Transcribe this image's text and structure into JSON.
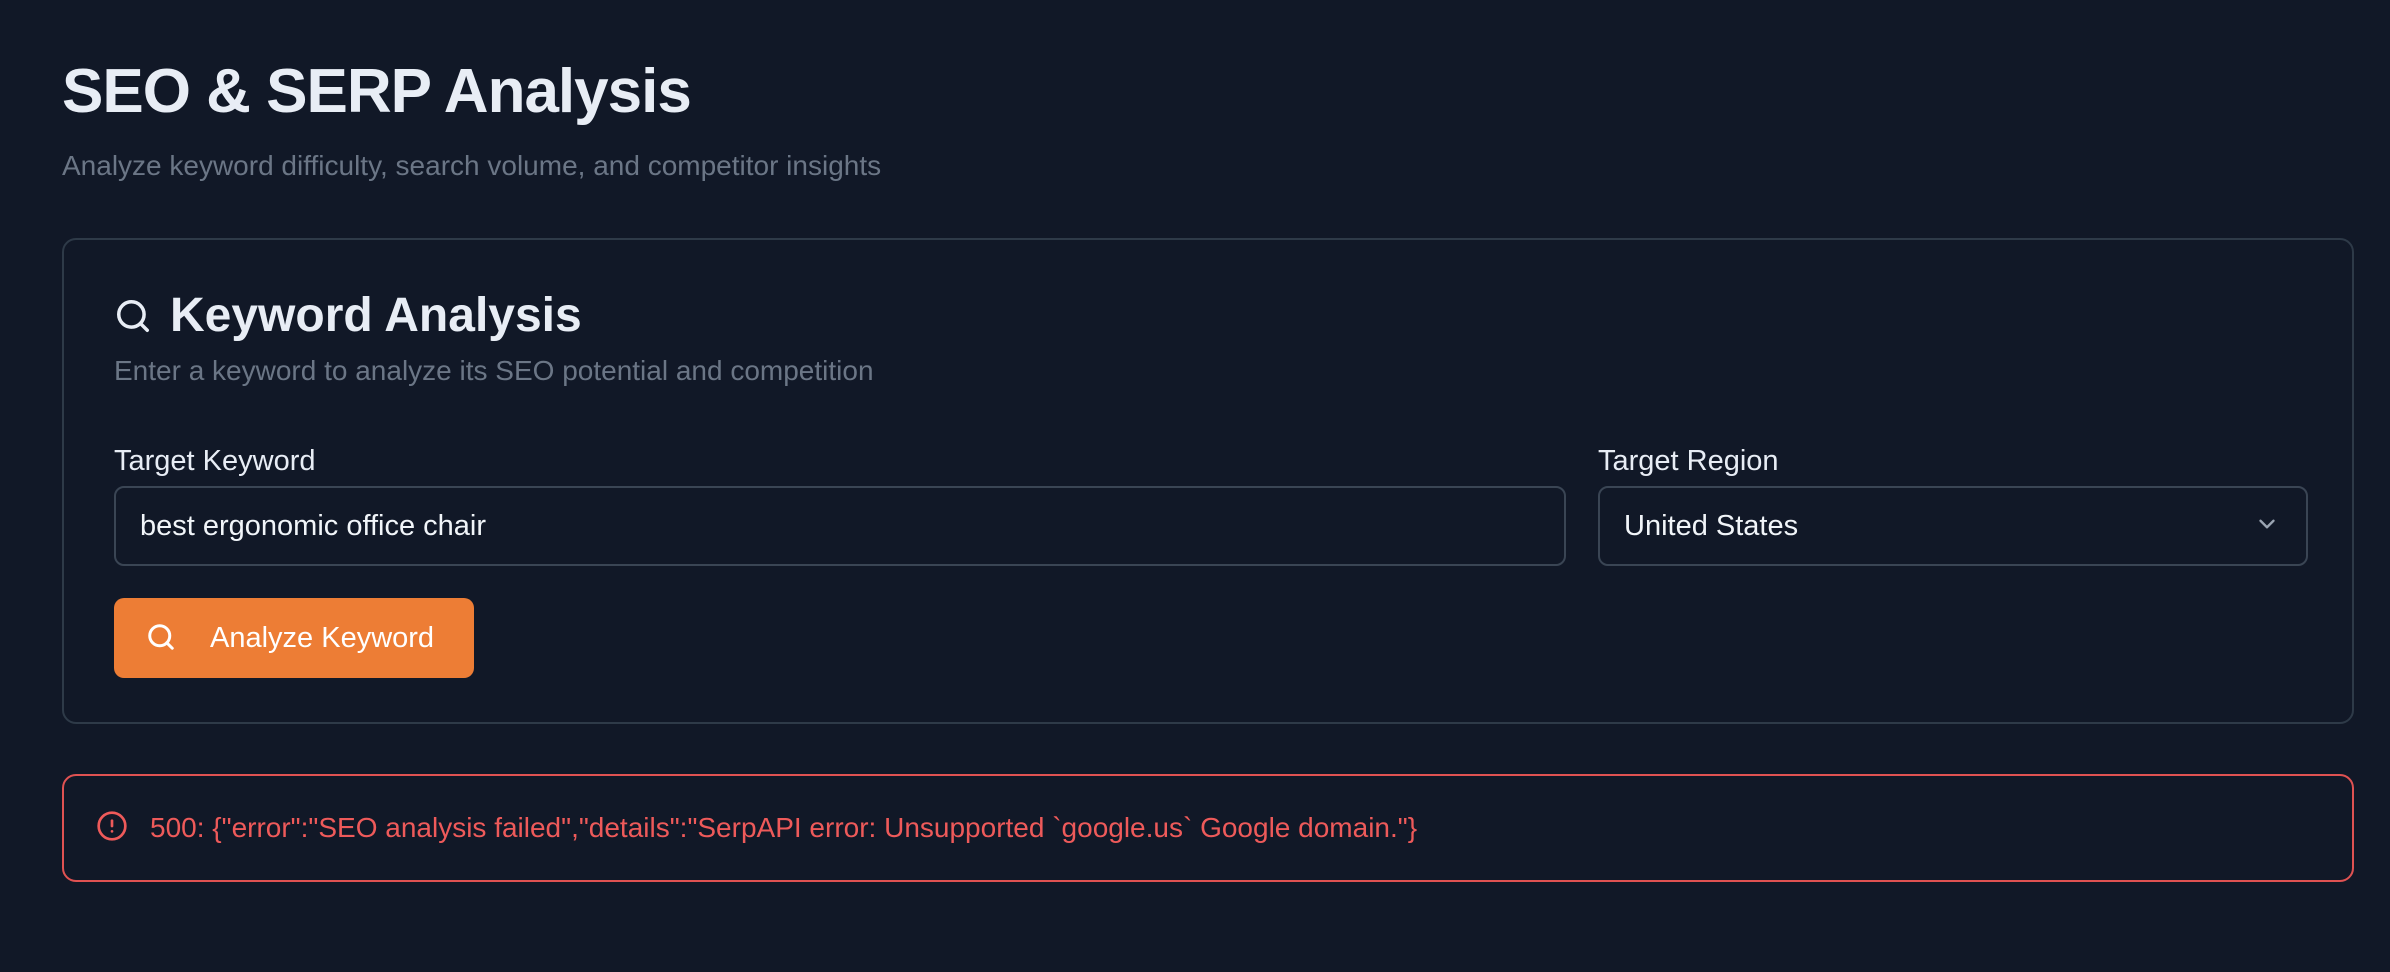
{
  "header": {
    "title": "SEO & SERP Analysis",
    "subtitle": "Analyze keyword difficulty, search volume, and competitor insights"
  },
  "card": {
    "icon": "search-icon",
    "title": "Keyword Analysis",
    "description": "Enter a keyword to analyze its SEO potential and competition"
  },
  "form": {
    "keyword_label": "Target Keyword",
    "keyword_value": "best ergonomic office chair",
    "region_label": "Target Region",
    "region_value": "United States",
    "analyze_label": "Analyze Keyword"
  },
  "error": {
    "icon": "alert-circle-icon",
    "message": "500: {\"error\":\"SEO analysis failed\",\"details\":\"SerpAPI error: Unsupported `google.us` Google domain.\"}"
  },
  "colors": {
    "background": "#111827",
    "accent": "#ed7d35",
    "error": "#e05252",
    "muted_text": "#6b7686",
    "border": "#2e3a48"
  }
}
